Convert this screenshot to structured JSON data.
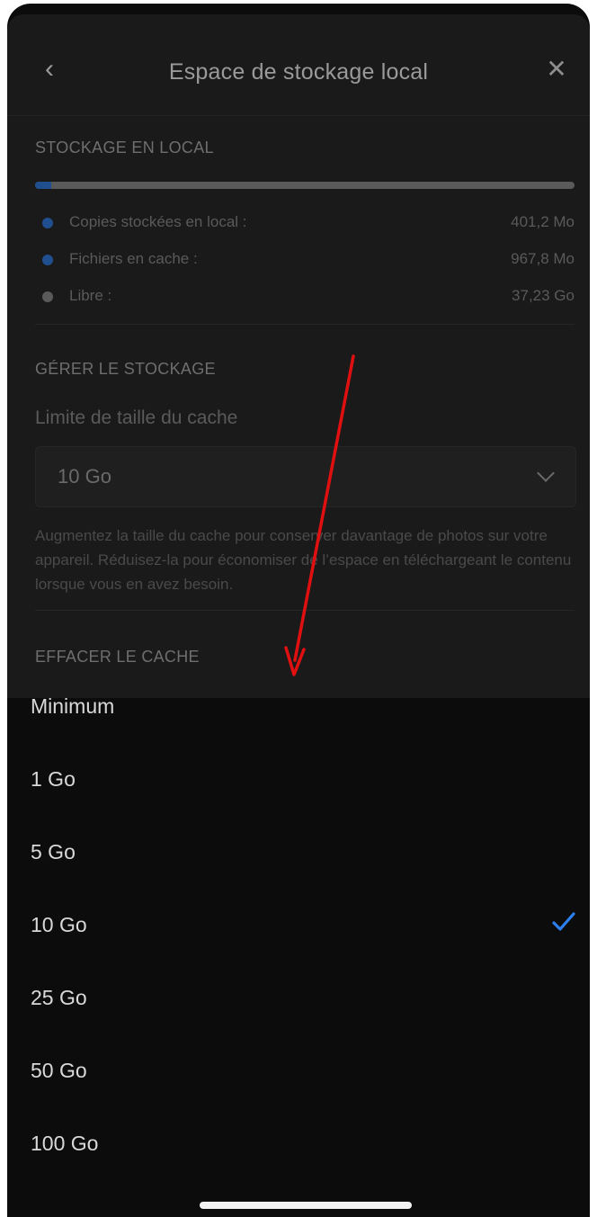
{
  "header": {
    "title": "Espace de stockage local",
    "back_icon": "chevron-left-icon",
    "close_icon": "close-icon"
  },
  "storage": {
    "section_title": "STOCKAGE EN LOCAL",
    "usage_fraction": 0.03,
    "legend": [
      {
        "label": "Copies stockées en local :",
        "value": "401,2 Mo",
        "color": "#1f4f8f"
      },
      {
        "label": "Fichiers en cache :",
        "value": "967,8 Mo",
        "color": "#1f4f8f"
      },
      {
        "label": "Libre :",
        "value": "37,23 Go",
        "color": "#5a5a5a"
      }
    ]
  },
  "manage": {
    "section_title": "GÉRER LE STOCKAGE",
    "cache_limit_label": "Limite de taille du cache",
    "cache_limit_value": "10 Go",
    "help_text": "Augmentez la taille du cache pour conserver davantage de photos sur votre appareil. Réduisez-la pour économiser de l’espace en téléchargeant le contenu lorsque vous en avez besoin."
  },
  "clear": {
    "section_title": "EFFACER LE CACHE"
  },
  "options": [
    {
      "label": "Minimum",
      "selected": false
    },
    {
      "label": "1 Go",
      "selected": false
    },
    {
      "label": "5 Go",
      "selected": false
    },
    {
      "label": "10 Go",
      "selected": true
    },
    {
      "label": "25 Go",
      "selected": false
    },
    {
      "label": "50 Go",
      "selected": false
    },
    {
      "label": "100 Go",
      "selected": false
    }
  ],
  "accent_color": "#2d7ff0",
  "annotation_arrow_color": "#e01010"
}
